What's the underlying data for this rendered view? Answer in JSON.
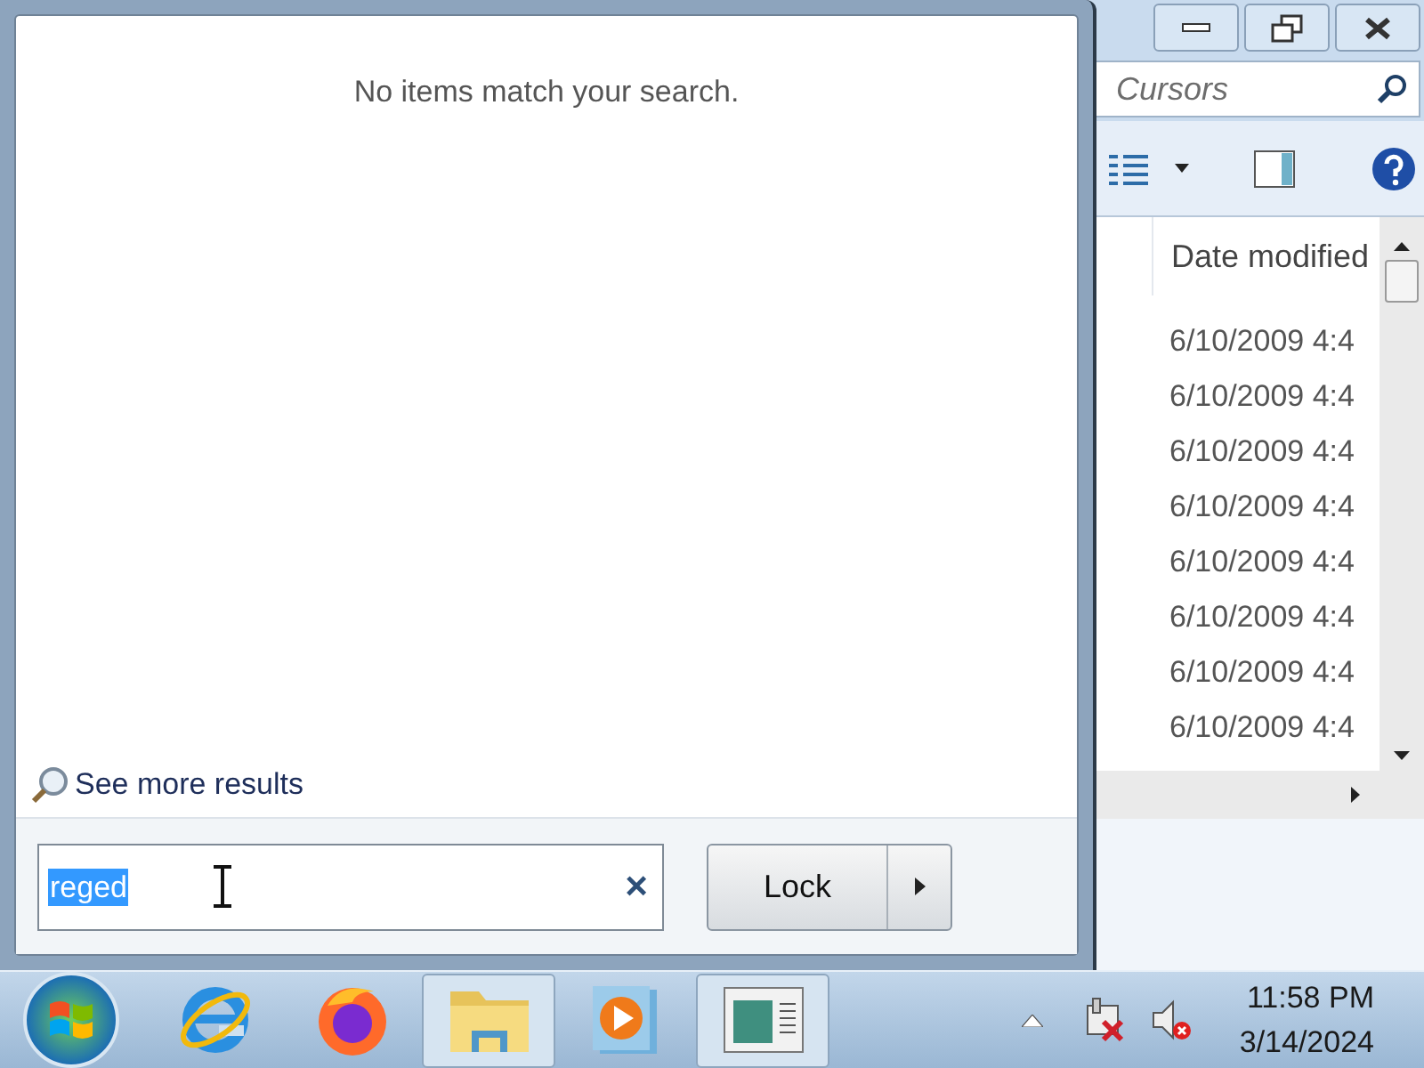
{
  "explorer": {
    "search_placeholder": "Cursors",
    "column": "Date modified",
    "rows": [
      "6/10/2009 4:4",
      "6/10/2009 4:4",
      "6/10/2009 4:4",
      "6/10/2009 4:4",
      "6/10/2009 4:4",
      "6/10/2009 4:4",
      "6/10/2009 4:4",
      "6/10/2009 4:4"
    ]
  },
  "start_menu": {
    "message": "No items match your search.",
    "see_more": "See more results",
    "search": {
      "value": "reged",
      "value_selected": true
    },
    "clear": "×",
    "power_button": {
      "label": "Lock"
    }
  },
  "taskbar": {
    "items": [
      {
        "kind": "ie",
        "open": false
      },
      {
        "kind": "firefox",
        "open": false
      },
      {
        "kind": "folder",
        "open": true
      },
      {
        "kind": "media",
        "open": false
      },
      {
        "kind": "window",
        "open": true
      }
    ],
    "clock": {
      "time": "11:58 PM",
      "date": "3/14/2024"
    }
  }
}
